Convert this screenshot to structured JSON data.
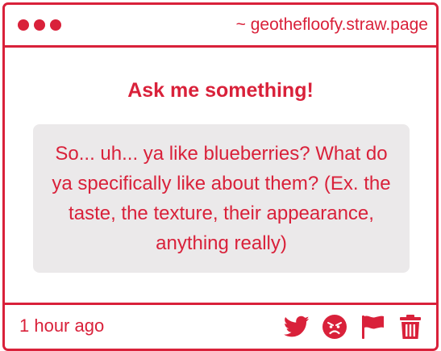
{
  "window": {
    "site_label": "~ geothefloofy.straw.page"
  },
  "prompt": {
    "heading": "Ask me something!",
    "question": "So... uh... ya like blueberries? What do ya specifically like about them? (Ex. the taste, the texture, their appearance, anything really)"
  },
  "footer": {
    "time_ago": "1 hour ago",
    "actions": [
      {
        "icon": "twitter-icon"
      },
      {
        "icon": "angry-face-icon"
      },
      {
        "icon": "flag-icon"
      },
      {
        "icon": "trash-icon"
      }
    ]
  },
  "colors": {
    "accent": "#d9213a",
    "question_bg": "#ebe9ea",
    "background": "#ffffff"
  }
}
